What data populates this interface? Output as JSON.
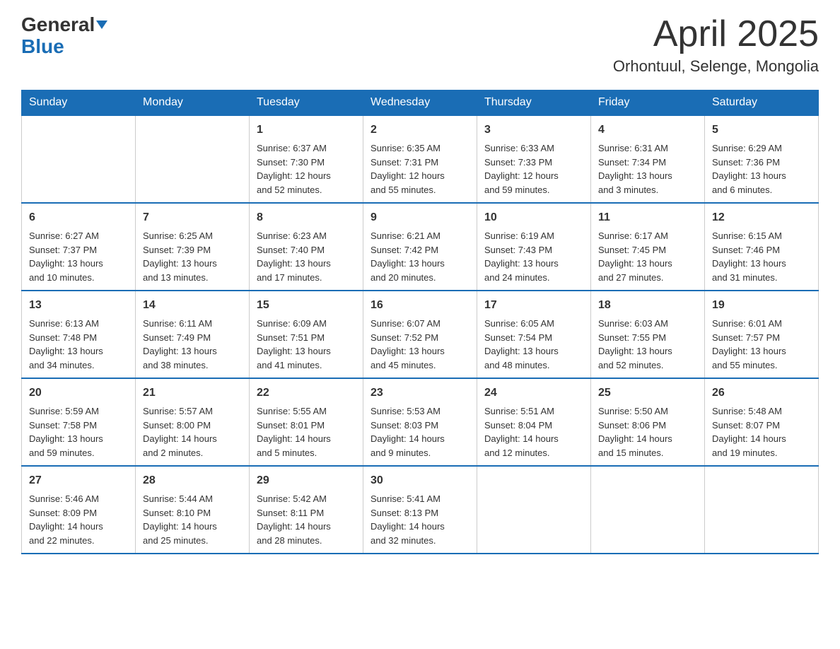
{
  "header": {
    "logo_general": "General",
    "logo_blue": "Blue",
    "month_title": "April 2025",
    "location": "Orhontuul, Selenge, Mongolia"
  },
  "weekdays": [
    "Sunday",
    "Monday",
    "Tuesday",
    "Wednesday",
    "Thursday",
    "Friday",
    "Saturday"
  ],
  "weeks": [
    [
      {
        "day": "",
        "info": ""
      },
      {
        "day": "",
        "info": ""
      },
      {
        "day": "1",
        "info": "Sunrise: 6:37 AM\nSunset: 7:30 PM\nDaylight: 12 hours\nand 52 minutes."
      },
      {
        "day": "2",
        "info": "Sunrise: 6:35 AM\nSunset: 7:31 PM\nDaylight: 12 hours\nand 55 minutes."
      },
      {
        "day": "3",
        "info": "Sunrise: 6:33 AM\nSunset: 7:33 PM\nDaylight: 12 hours\nand 59 minutes."
      },
      {
        "day": "4",
        "info": "Sunrise: 6:31 AM\nSunset: 7:34 PM\nDaylight: 13 hours\nand 3 minutes."
      },
      {
        "day": "5",
        "info": "Sunrise: 6:29 AM\nSunset: 7:36 PM\nDaylight: 13 hours\nand 6 minutes."
      }
    ],
    [
      {
        "day": "6",
        "info": "Sunrise: 6:27 AM\nSunset: 7:37 PM\nDaylight: 13 hours\nand 10 minutes."
      },
      {
        "day": "7",
        "info": "Sunrise: 6:25 AM\nSunset: 7:39 PM\nDaylight: 13 hours\nand 13 minutes."
      },
      {
        "day": "8",
        "info": "Sunrise: 6:23 AM\nSunset: 7:40 PM\nDaylight: 13 hours\nand 17 minutes."
      },
      {
        "day": "9",
        "info": "Sunrise: 6:21 AM\nSunset: 7:42 PM\nDaylight: 13 hours\nand 20 minutes."
      },
      {
        "day": "10",
        "info": "Sunrise: 6:19 AM\nSunset: 7:43 PM\nDaylight: 13 hours\nand 24 minutes."
      },
      {
        "day": "11",
        "info": "Sunrise: 6:17 AM\nSunset: 7:45 PM\nDaylight: 13 hours\nand 27 minutes."
      },
      {
        "day": "12",
        "info": "Sunrise: 6:15 AM\nSunset: 7:46 PM\nDaylight: 13 hours\nand 31 minutes."
      }
    ],
    [
      {
        "day": "13",
        "info": "Sunrise: 6:13 AM\nSunset: 7:48 PM\nDaylight: 13 hours\nand 34 minutes."
      },
      {
        "day": "14",
        "info": "Sunrise: 6:11 AM\nSunset: 7:49 PM\nDaylight: 13 hours\nand 38 minutes."
      },
      {
        "day": "15",
        "info": "Sunrise: 6:09 AM\nSunset: 7:51 PM\nDaylight: 13 hours\nand 41 minutes."
      },
      {
        "day": "16",
        "info": "Sunrise: 6:07 AM\nSunset: 7:52 PM\nDaylight: 13 hours\nand 45 minutes."
      },
      {
        "day": "17",
        "info": "Sunrise: 6:05 AM\nSunset: 7:54 PM\nDaylight: 13 hours\nand 48 minutes."
      },
      {
        "day": "18",
        "info": "Sunrise: 6:03 AM\nSunset: 7:55 PM\nDaylight: 13 hours\nand 52 minutes."
      },
      {
        "day": "19",
        "info": "Sunrise: 6:01 AM\nSunset: 7:57 PM\nDaylight: 13 hours\nand 55 minutes."
      }
    ],
    [
      {
        "day": "20",
        "info": "Sunrise: 5:59 AM\nSunset: 7:58 PM\nDaylight: 13 hours\nand 59 minutes."
      },
      {
        "day": "21",
        "info": "Sunrise: 5:57 AM\nSunset: 8:00 PM\nDaylight: 14 hours\nand 2 minutes."
      },
      {
        "day": "22",
        "info": "Sunrise: 5:55 AM\nSunset: 8:01 PM\nDaylight: 14 hours\nand 5 minutes."
      },
      {
        "day": "23",
        "info": "Sunrise: 5:53 AM\nSunset: 8:03 PM\nDaylight: 14 hours\nand 9 minutes."
      },
      {
        "day": "24",
        "info": "Sunrise: 5:51 AM\nSunset: 8:04 PM\nDaylight: 14 hours\nand 12 minutes."
      },
      {
        "day": "25",
        "info": "Sunrise: 5:50 AM\nSunset: 8:06 PM\nDaylight: 14 hours\nand 15 minutes."
      },
      {
        "day": "26",
        "info": "Sunrise: 5:48 AM\nSunset: 8:07 PM\nDaylight: 14 hours\nand 19 minutes."
      }
    ],
    [
      {
        "day": "27",
        "info": "Sunrise: 5:46 AM\nSunset: 8:09 PM\nDaylight: 14 hours\nand 22 minutes."
      },
      {
        "day": "28",
        "info": "Sunrise: 5:44 AM\nSunset: 8:10 PM\nDaylight: 14 hours\nand 25 minutes."
      },
      {
        "day": "29",
        "info": "Sunrise: 5:42 AM\nSunset: 8:11 PM\nDaylight: 14 hours\nand 28 minutes."
      },
      {
        "day": "30",
        "info": "Sunrise: 5:41 AM\nSunset: 8:13 PM\nDaylight: 14 hours\nand 32 minutes."
      },
      {
        "day": "",
        "info": ""
      },
      {
        "day": "",
        "info": ""
      },
      {
        "day": "",
        "info": ""
      }
    ]
  ]
}
